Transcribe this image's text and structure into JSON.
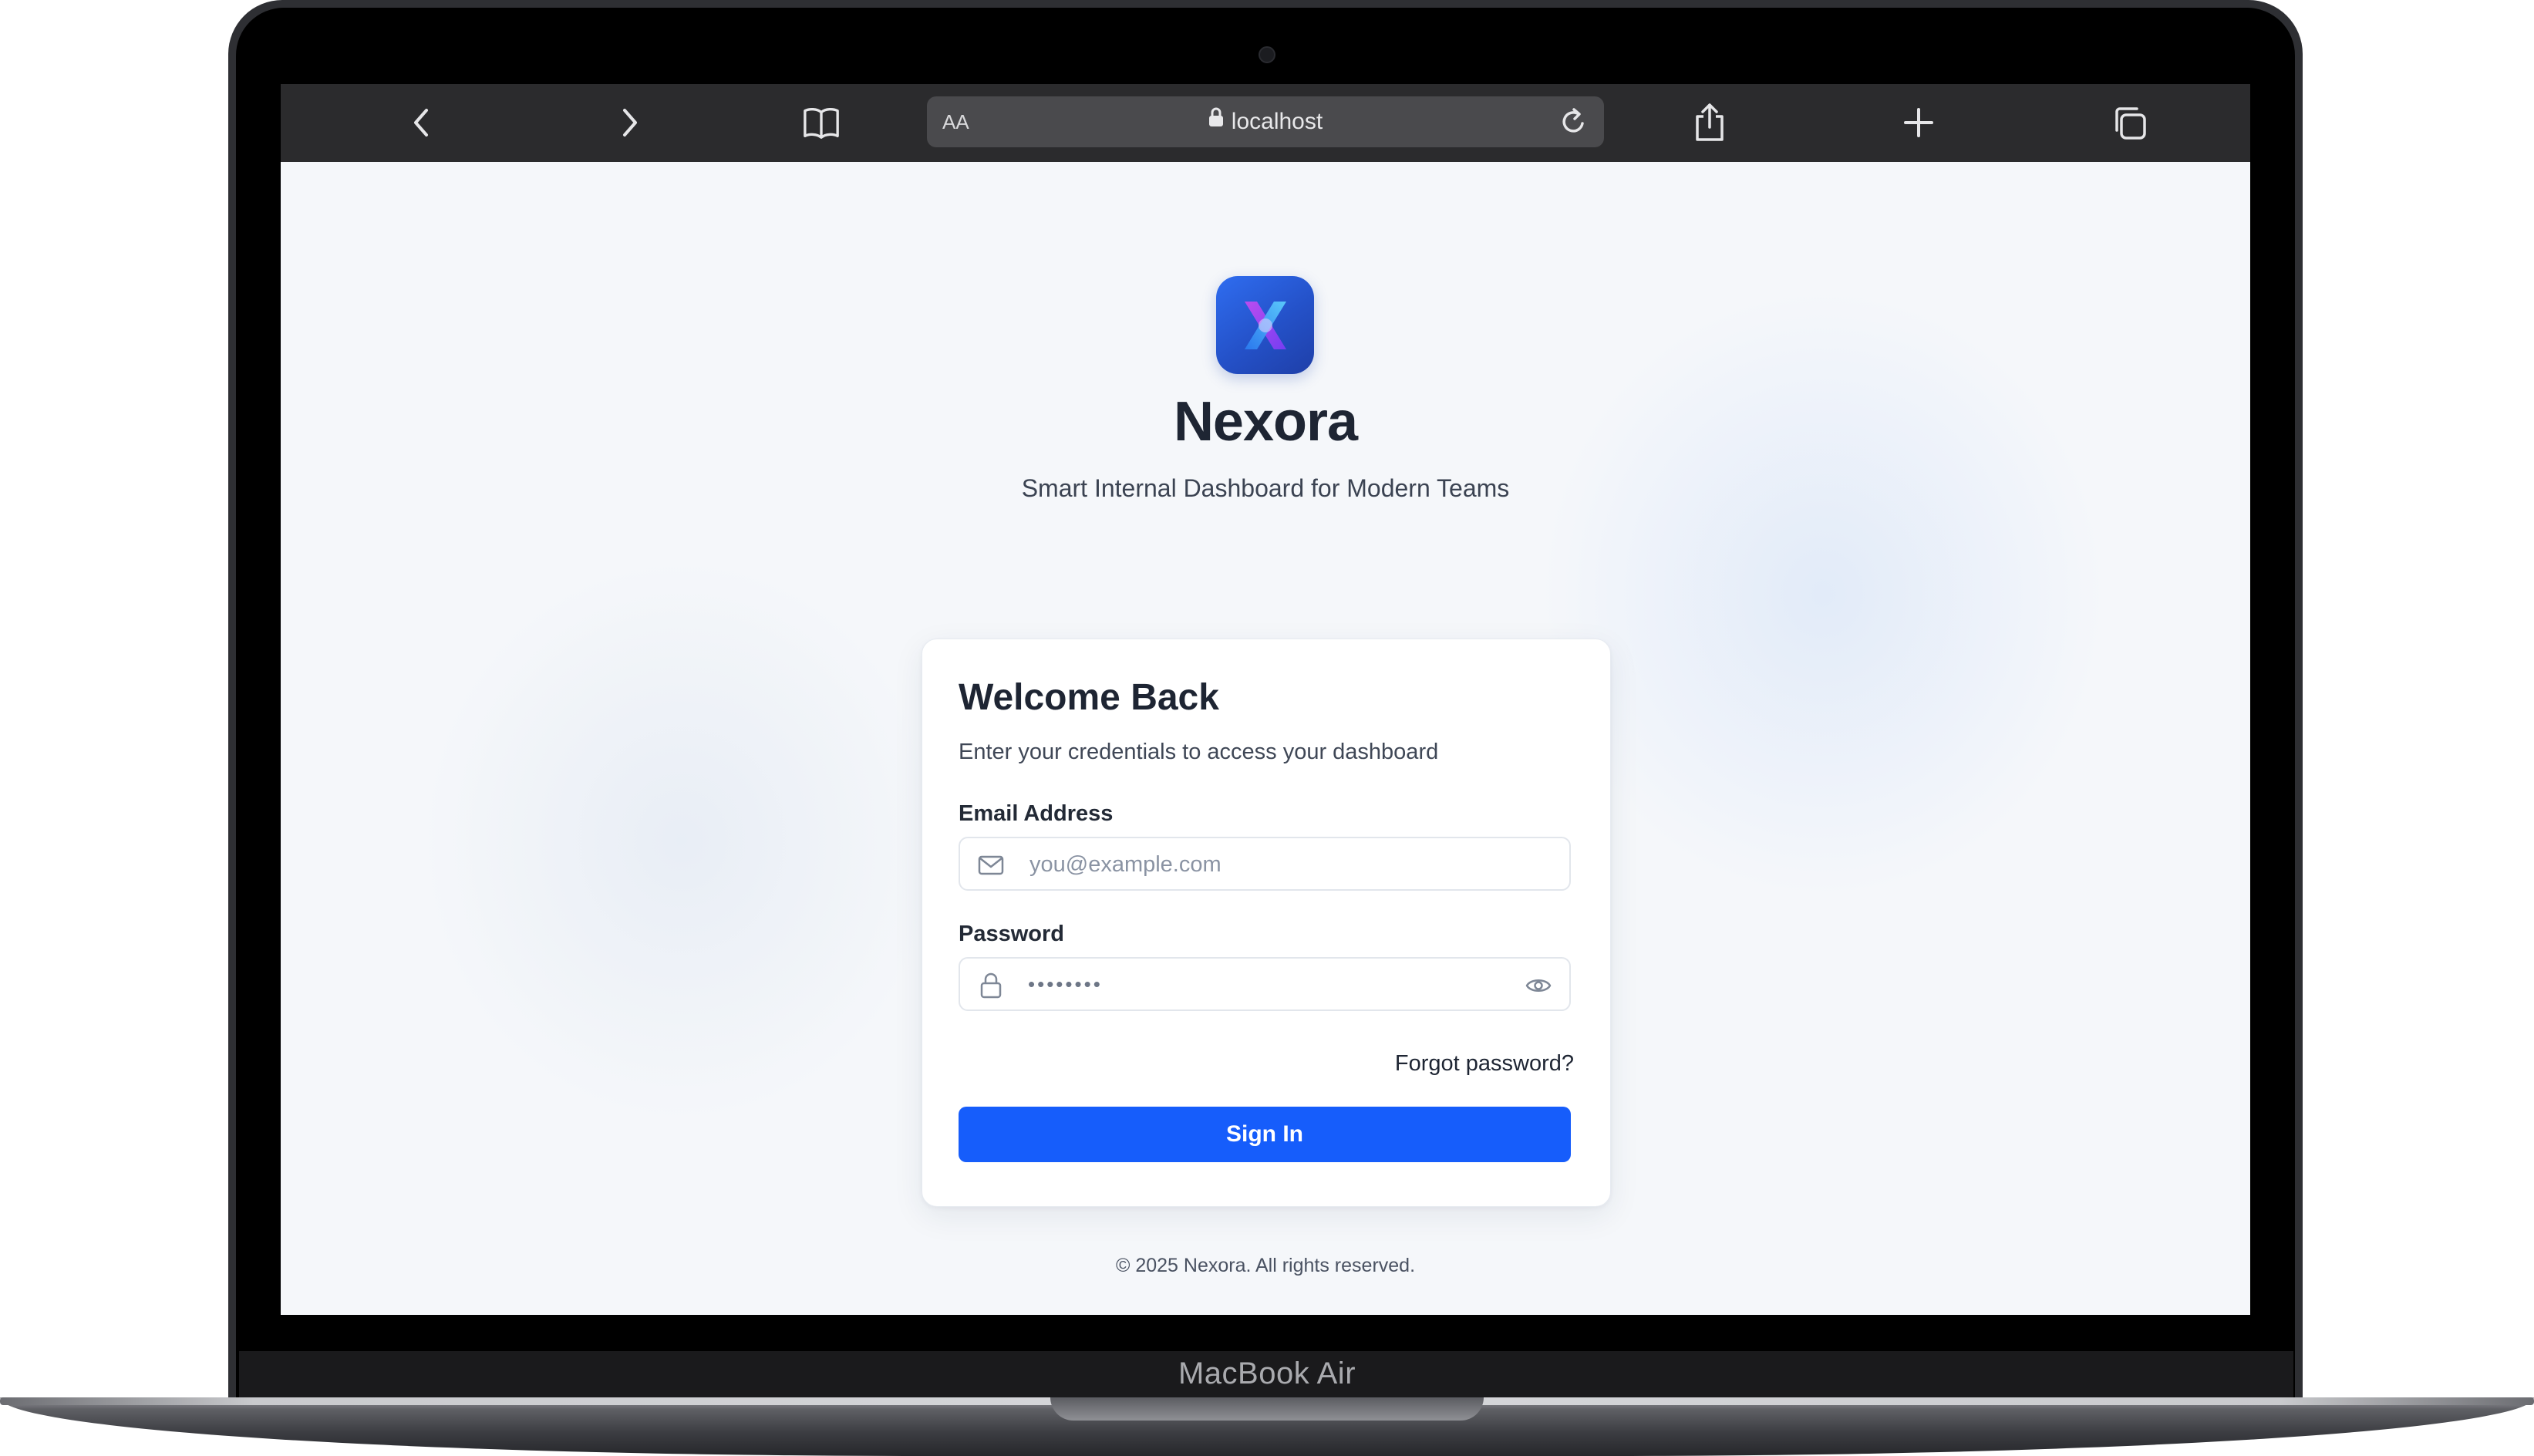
{
  "device": {
    "model_label": "MacBook Air"
  },
  "browser": {
    "text_size_button": "AA",
    "url": "localhost"
  },
  "brand": {
    "name": "Nexora",
    "tagline": "Smart Internal Dashboard for Modern Teams",
    "logo_colors": [
      "#2f6df0",
      "#8b3cf6",
      "#19b4f0"
    ]
  },
  "login_card": {
    "title": "Welcome Back",
    "subtitle": "Enter your credentials to access your dashboard",
    "email": {
      "label": "Email Address",
      "placeholder": "you@example.com",
      "value": ""
    },
    "password": {
      "label": "Password",
      "masked_value": "••••••••"
    },
    "forgot_password": "Forgot password?",
    "submit_label": "Sign In",
    "accent_color": "#165dfb"
  },
  "footer": {
    "copyright": "© 2025 Nexora. All rights reserved."
  },
  "icons": {
    "toolbar": [
      "back-icon",
      "forward-icon",
      "bookmarks-icon",
      "lock-icon",
      "reload-icon",
      "share-icon",
      "new-tab-icon",
      "tabs-icon"
    ],
    "fields": [
      "mail-icon",
      "lock-icon",
      "eye-icon"
    ]
  }
}
